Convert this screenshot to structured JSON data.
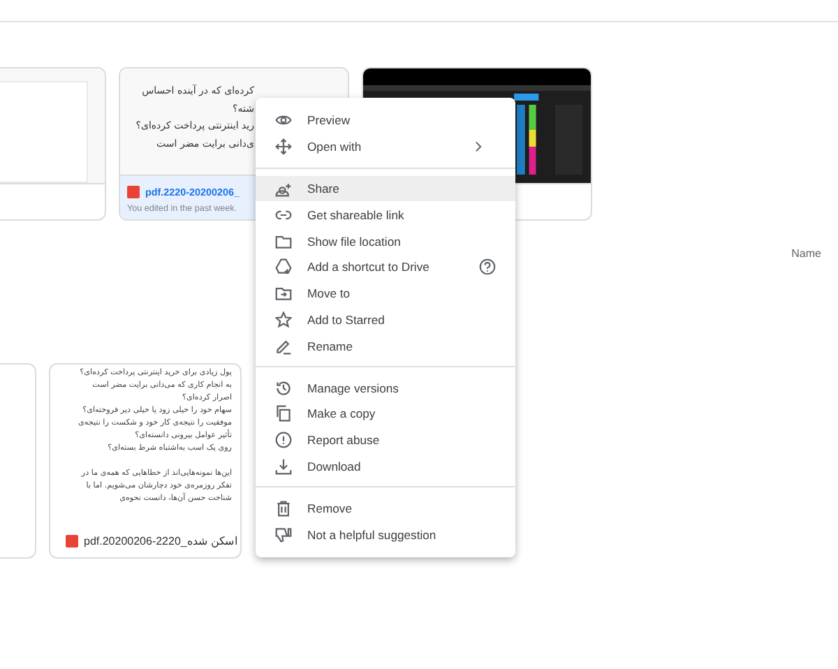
{
  "top_cards": [
    {
      "kind": "blank",
      "selected": false
    },
    {
      "kind": "document",
      "selected": true,
      "lines": [
        "کرده‌ای که در آینده احساس",
        "شته؟",
        "رید اینترنتی پرداخت کرده‌ای؟",
        "ی‌دانی برایت مضر است"
      ],
      "file_name": "pdf.2220-20200206_",
      "subtitle": "You edited in the past week."
    },
    {
      "kind": "picture",
      "selected": false
    }
  ],
  "sort_label": "Name",
  "bottom_cards": [
    {
      "kind": "blank"
    },
    {
      "kind": "document",
      "lines": [
        "پول زیادی برای خرید اینترنتی پرداخت کرده‌ای؟",
        "به انجام کاری که می‌دانی برایت مضر است",
        "اصرار کرده‌ای؟",
        "سهام خود را خیلی زود یا خیلی دیر فروخته‌ای؟",
        "موفقیت را نتیجه‌ی کار خود و شکست را نتیجه‌ی",
        "تأثیر عوامل بیرونی دانسته‌ای؟",
        "روی یک اسب به‌اشتباه شرط بسته‌ای؟"
      ],
      "lines_2": [
        "این‌ها نمونه‌هایی‌اند از خطاهایی که همه‌ی ما در",
        "تفکر روزمره‌ی خود دچارشان می‌شویم. اما با",
        "شناخت حسن آن‌ها، دانست نحوه‌ی"
      ],
      "file_name": "pdf.اسکن شده_2220-20200206"
    }
  ],
  "menu": [
    [
      {
        "label": "Preview",
        "selected": false
      },
      {
        "label": "Open with",
        "selected": false,
        "submenu": true
      }
    ],
    [
      {
        "label": "Share",
        "selected": true
      },
      {
        "label": "Get shareable link",
        "selected": false
      },
      {
        "label": "Show file location",
        "selected": false
      },
      {
        "label": "Add a shortcut to Drive",
        "selected": false,
        "help": true
      },
      {
        "label": "Move to",
        "selected": false
      },
      {
        "label": "Add to Starred",
        "selected": false
      },
      {
        "label": "Rename",
        "selected": false
      }
    ],
    [
      {
        "label": "Manage versions",
        "selected": false
      },
      {
        "label": "Make a copy",
        "selected": false
      },
      {
        "label": "Report abuse",
        "selected": false
      },
      {
        "label": "Download",
        "selected": false
      }
    ],
    [
      {
        "label": "Remove",
        "selected": false
      },
      {
        "label": "Not a helpful suggestion",
        "selected": false
      }
    ]
  ]
}
